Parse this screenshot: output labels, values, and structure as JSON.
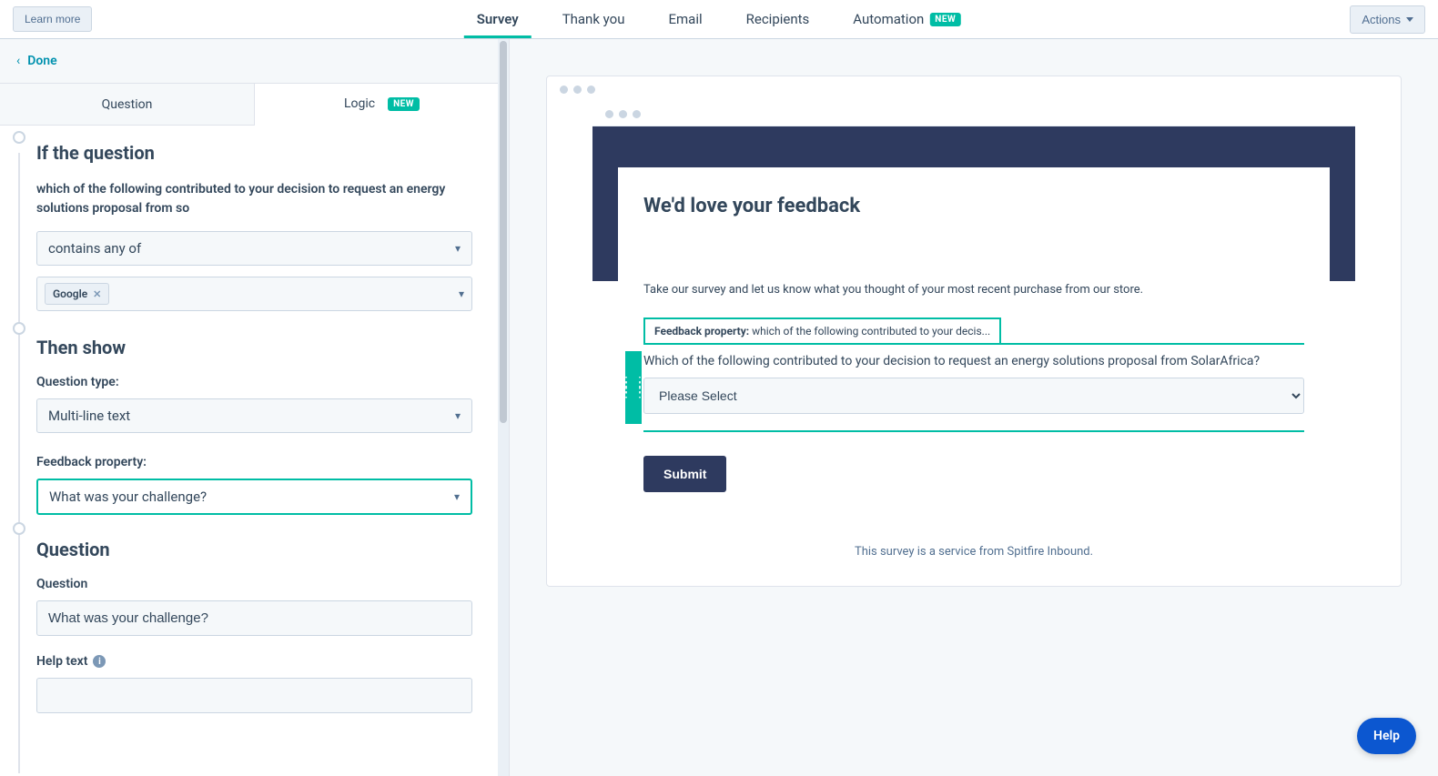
{
  "topbar": {
    "learn_more": "Learn more",
    "tabs": {
      "survey": "Survey",
      "thank_you": "Thank you",
      "email": "Email",
      "recipients": "Recipients",
      "automation": "Automation"
    },
    "new_badge": "NEW",
    "actions": "Actions"
  },
  "left": {
    "done": "Done",
    "sub_tabs": {
      "question": "Question",
      "logic": "Logic",
      "new_badge": "NEW"
    },
    "if_title": "If the question",
    "condition_text": "which of the following contributed to your decision to request an energy solutions proposal from so",
    "operator": "contains any of",
    "tag": "Google",
    "then_title": "Then show",
    "question_type_label": "Question type:",
    "question_type_value": "Multi-line text",
    "feedback_prop_label": "Feedback property:",
    "feedback_prop_value": "What was your challenge?",
    "question_section_title": "Question",
    "question_label": "Question",
    "question_value": "What was your challenge?",
    "help_text_label": "Help text",
    "help_text_value": ""
  },
  "preview": {
    "title": "We'd love your feedback",
    "desc": "Take our survey and let us know what you thought of your most recent purchase from our store.",
    "prop_prefix": "Feedback property:",
    "prop_text": "which of the following contributed to your decis...",
    "question": "Which of the following contributed to your decision to request an energy solutions proposal from SolarAfrica?",
    "select_placeholder": "Please Select",
    "submit": "Submit",
    "footer": "This survey is a service from Spitfire Inbound."
  },
  "help_fab": "Help"
}
